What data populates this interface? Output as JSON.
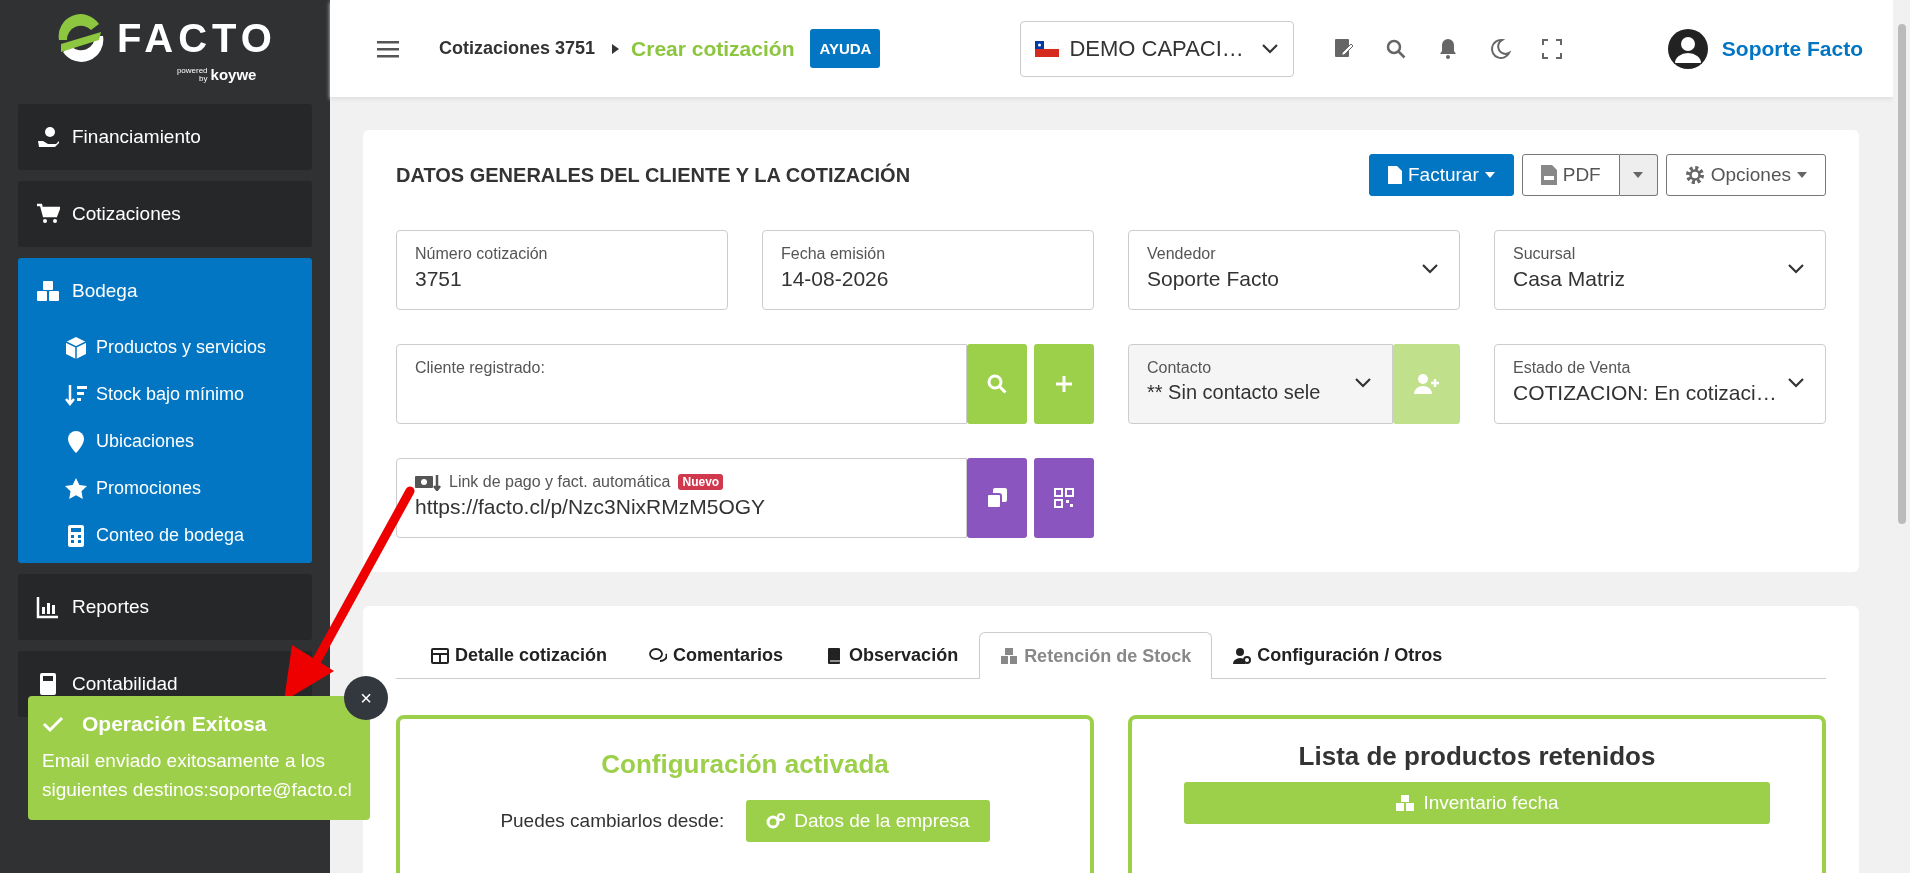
{
  "sidebar": {
    "logo": {
      "name": "FACTO",
      "tagline": "powered by",
      "brand": "koywe"
    },
    "items": [
      {
        "label": "Financiamiento",
        "selected": false
      },
      {
        "label": "Cotizaciones",
        "selected": false
      },
      {
        "label": "Bodega",
        "selected": true,
        "children": [
          {
            "label": "Productos y servicios"
          },
          {
            "label": "Stock bajo mínimo"
          },
          {
            "label": "Ubicaciones"
          },
          {
            "label": "Promociones"
          },
          {
            "label": "Conteo de bodega"
          }
        ]
      },
      {
        "label": "Reportes",
        "selected": false
      },
      {
        "label": "Contabilidad",
        "selected": false
      }
    ]
  },
  "header": {
    "breadcrumb": "Cotizaciones 3751",
    "current": "Crear cotización",
    "help": "AYUDA",
    "company": "DEMO CAPACI…",
    "user": "Soporte Facto"
  },
  "card": {
    "title": "DATOS GENERALES DEL CLIENTE Y LA COTIZACIÓN",
    "actions": [
      {
        "kind": "primary",
        "label": "Facturar"
      },
      {
        "kind": "split",
        "label": "PDF"
      },
      {
        "kind": "outline",
        "label": "Opciones"
      }
    ],
    "fields": [
      {
        "kind": "text",
        "label": "Número cotización",
        "value": "3751"
      },
      {
        "kind": "text",
        "label": "Fecha emisión",
        "value": "14-08-2026"
      },
      {
        "kind": "select",
        "label": "Vendedor",
        "value": "Soporte Facto"
      },
      {
        "kind": "select",
        "label": "Sucursal",
        "value": "Casa Matriz"
      },
      {
        "kind": "search",
        "label": "Cliente registrado:"
      },
      {
        "kind": "contact",
        "label": "Contacto",
        "value": "** Sin contacto sele"
      },
      {
        "kind": "select",
        "label": "Estado de Venta",
        "value": "COTIZACION: En cotizaci…"
      },
      {
        "kind": "link",
        "label": "Link de pago y fact. automática",
        "badge": "Nuevo",
        "value": "https://facto.cl/p/Nzc3NixRMzM5OGY"
      }
    ]
  },
  "tabs": [
    {
      "label": "Detalle cotización",
      "selected": false
    },
    {
      "label": "Comentarios",
      "selected": false
    },
    {
      "label": "Observación",
      "selected": false
    },
    {
      "label": "Retención de Stock",
      "selected": true
    },
    {
      "label": "Configuración / Otros",
      "selected": false
    }
  ],
  "panels": [
    {
      "title": "Configuración activada",
      "text": "Puedes cambiarlos desde:",
      "button": "Datos de la empresa"
    },
    {
      "title": "Lista de productos retenidos",
      "button": "Inventario fecha"
    }
  ],
  "toast": {
    "title": "Operación Exitosa",
    "message": "Email enviado exitosamente a los siguientes destinos:soporte@facto.cl",
    "close": "×"
  }
}
